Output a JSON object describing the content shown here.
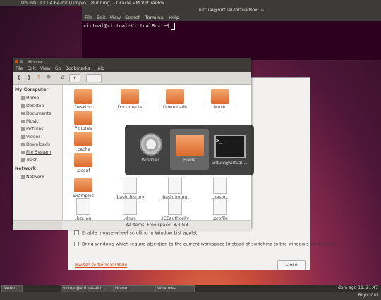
{
  "host": {
    "title": "Ubuntu 13.04 64-bit (Limpio) [Running] - Oracle VM VirtualBox"
  },
  "terminal": {
    "title": "virtual@virtual-VirtualBox: ~",
    "menu": [
      "File",
      "Edit",
      "View",
      "Search",
      "Terminal",
      "Help"
    ],
    "prompt": "virtual@virtual-VirtualBox:~$"
  },
  "nautilus": {
    "title": "Home",
    "menu": [
      "File",
      "Edit",
      "View",
      "Go",
      "Bookmarks",
      "Help"
    ],
    "sidebar": {
      "my_computer": "My Computer",
      "items": [
        "Home",
        "Desktop",
        "Documents",
        "Music",
        "Pictures",
        "Videos",
        "Downloads",
        "File System",
        "Trash"
      ],
      "network": "Network",
      "network_items": [
        "Network"
      ]
    },
    "files": [
      {
        "name": "Desktop",
        "kind": "folder"
      },
      {
        "name": "Documents",
        "kind": "folder"
      },
      {
        "name": "Downloads",
        "kind": "folder"
      },
      {
        "name": "Music",
        "kind": "folder"
      },
      {
        "name": "Pictures",
        "kind": "folder"
      },
      {
        "name": ".cache",
        "kind": "folder"
      },
      {
        "name": ".gconf",
        "kind": "folder"
      },
      {
        "name": "Examples",
        "kind": "folder"
      },
      {
        "name": ".bash_history",
        "kind": "doc"
      },
      {
        "name": ".bash_logout",
        "kind": "doc"
      },
      {
        "name": ".bashrc",
        "kind": "doc"
      },
      {
        "name": ".bzr.log",
        "kind": "doc"
      },
      {
        "name": ".dmrc",
        "kind": "doc"
      },
      {
        "name": ".ICEauthority",
        "kind": "doc"
      },
      {
        "name": ".profile",
        "kind": "doc"
      }
    ],
    "status": "32 items, Free space: 8,4 GB"
  },
  "switcher": {
    "items": [
      "Windows",
      "Home",
      "virtual@virtual-..."
    ]
  },
  "dialog": {
    "option1": "Enable mouse-wheel scrolling in Window List applet",
    "option2": "Bring windows which require attention to the current workspace (instead of switching to the window's workspace)",
    "normal_mode": "Switch to Normal Mode",
    "close": "Close"
  },
  "taskbar": {
    "buttons": [
      "Menu",
      "virtual@virtual-Virt...",
      "Home",
      "Windows"
    ],
    "clock": "dom ago 11, 21:47",
    "ctrl": "Right Ctrl"
  },
  "colors": {
    "accent": "#dd4814",
    "panel": "#3c3b37",
    "terminal_bg": "#2c001e"
  }
}
